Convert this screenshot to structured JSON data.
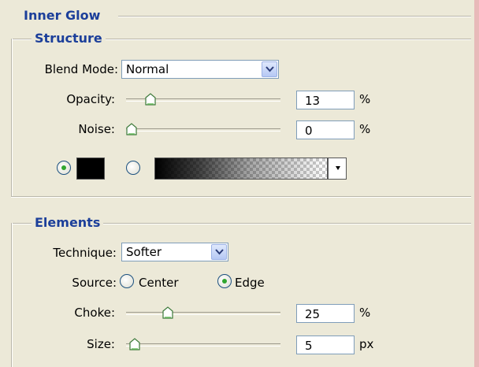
{
  "header": {
    "title": "Inner Glow"
  },
  "structure": {
    "title": "Structure",
    "blend_mode_label": "Blend Mode:",
    "blend_mode_value": "Normal",
    "opacity_label": "Opacity:",
    "opacity_value": "13",
    "opacity_unit": "%",
    "noise_label": "Noise:",
    "noise_value": "0",
    "noise_unit": "%",
    "glow_source": "color",
    "color_swatch": "#000000"
  },
  "elements": {
    "title": "Elements",
    "technique_label": "Technique:",
    "technique_value": "Softer",
    "source_label": "Source:",
    "source_center_label": "Center",
    "source_edge_label": "Edge",
    "source_selected": "edge",
    "choke_label": "Choke:",
    "choke_value": "25",
    "choke_unit": "%",
    "size_label": "Size:",
    "size_value": "5",
    "size_unit": "px"
  },
  "colors": {
    "heading": "#1c3f9a",
    "panel": "#ece9d8",
    "frame": "#e8b9b9",
    "radio_dot": "#31a62f"
  },
  "icons": [
    "chevron-down-icon",
    "slider-thumb-icon",
    "radio-icon",
    "dropdown-arrow-icon"
  ]
}
